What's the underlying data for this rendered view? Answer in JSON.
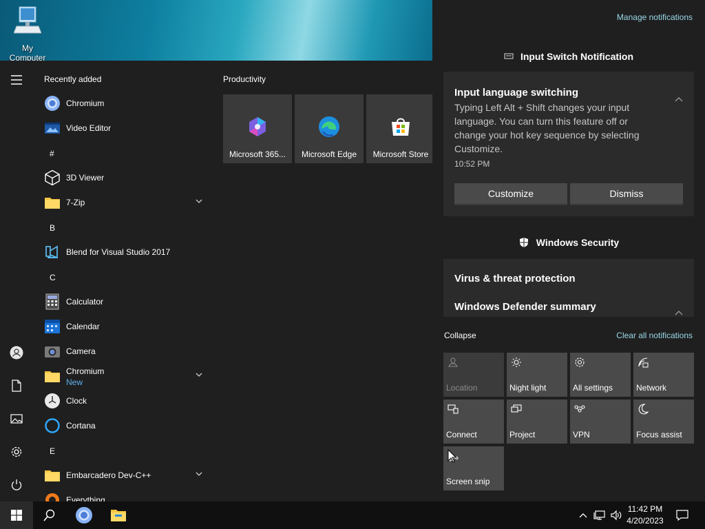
{
  "desktop": {
    "icon_label": "My Computer"
  },
  "start": {
    "recent_header": "Recently added",
    "apps": [
      {
        "name": "Chromium",
        "icon": "chromium-icon"
      },
      {
        "name": "Video Editor",
        "icon": "video-editor-icon"
      },
      {
        "letter": "#"
      },
      {
        "name": "3D Viewer",
        "icon": "cube-icon"
      },
      {
        "name": "7-Zip",
        "icon": "folder-icon",
        "expandable": true
      },
      {
        "letter": "B"
      },
      {
        "name": "Blend for Visual Studio 2017",
        "icon": "blend-icon"
      },
      {
        "letter": "C"
      },
      {
        "name": "Calculator",
        "icon": "calculator-icon"
      },
      {
        "name": "Calendar",
        "icon": "calendar-icon"
      },
      {
        "name": "Camera",
        "icon": "camera-icon"
      },
      {
        "name": "Chromium",
        "sub": "New",
        "icon": "folder-icon",
        "expandable": true
      },
      {
        "name": "Clock",
        "icon": "clock-icon"
      },
      {
        "name": "Cortana",
        "icon": "cortana-icon"
      },
      {
        "letter": "E"
      },
      {
        "name": "Embarcadero Dev-C++",
        "icon": "folder-icon",
        "expandable": true
      },
      {
        "name": "Everything",
        "icon": "everything-icon"
      }
    ],
    "tile_group": "Productivity",
    "tiles": [
      {
        "label": "Microsoft 365...",
        "icon": "m365-icon"
      },
      {
        "label": "Microsoft Edge",
        "icon": "edge-icon"
      },
      {
        "label": "Microsoft Store",
        "icon": "store-icon"
      }
    ]
  },
  "action_center": {
    "manage": "Manage notifications",
    "input_group": "Input Switch Notification",
    "input_card": {
      "title": "Input language switching",
      "body": "Typing Left Alt + Shift changes your input language. You can turn this feature off or change your hot key sequence by selecting Customize.",
      "time": "10:52 PM",
      "customize": "Customize",
      "dismiss": "Dismiss"
    },
    "security_group": "Windows Security",
    "security_card": {
      "line1": "Virus & threat protection",
      "line2": "Windows Defender summary"
    },
    "collapse": "Collapse",
    "clear_all": "Clear all notifications",
    "quick_actions": [
      {
        "label": "Location",
        "icon": "location-icon",
        "dim": true
      },
      {
        "label": "Night light",
        "icon": "night-light-icon"
      },
      {
        "label": "All settings",
        "icon": "settings-icon"
      },
      {
        "label": "Network",
        "icon": "network-icon"
      },
      {
        "label": "Connect",
        "icon": "connect-icon"
      },
      {
        "label": "Project",
        "icon": "project-icon"
      },
      {
        "label": "VPN",
        "icon": "vpn-icon"
      },
      {
        "label": "Focus assist",
        "icon": "moon-icon"
      },
      {
        "label": "Screen snip",
        "icon": "screen-snip-icon"
      }
    ]
  },
  "taskbar": {
    "time": "11:42 PM",
    "date": "4/20/2023"
  }
}
